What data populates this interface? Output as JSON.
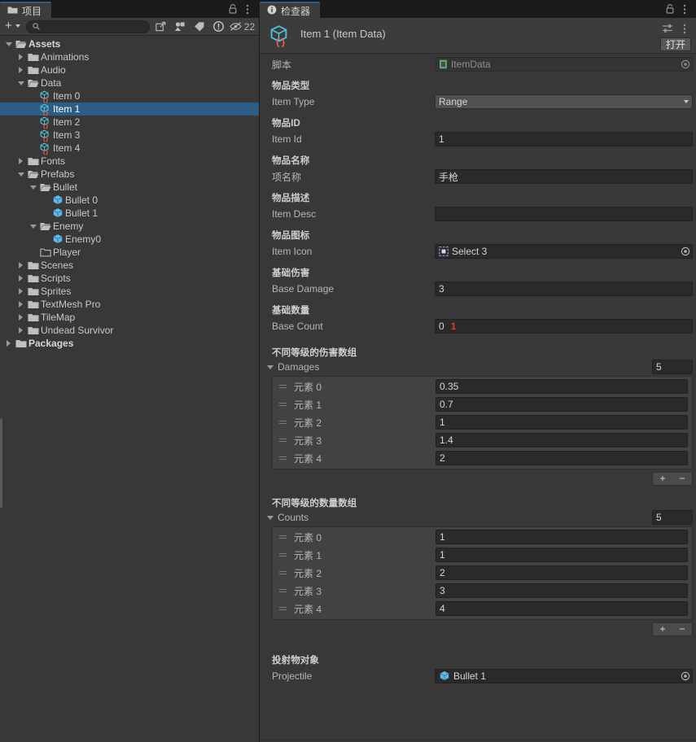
{
  "project": {
    "tab_label": "项目",
    "tab_icon": "folder-icon",
    "toolbar": {
      "add_label": "+",
      "search_value": "",
      "search_placeholder": "",
      "hidden_count": "22"
    },
    "tree": [
      {
        "label": "Assets",
        "depth": 0,
        "expand": "down",
        "icon": "folder-open-icon",
        "bold": true,
        "selected": false
      },
      {
        "label": "Animations",
        "depth": 1,
        "expand": "right",
        "icon": "folder-icon",
        "bold": false,
        "selected": false
      },
      {
        "label": "Audio",
        "depth": 1,
        "expand": "right",
        "icon": "folder-icon",
        "bold": false,
        "selected": false
      },
      {
        "label": "Data",
        "depth": 1,
        "expand": "down",
        "icon": "folder-open-icon",
        "bold": false,
        "selected": false
      },
      {
        "label": "Item 0",
        "depth": 2,
        "expand": "none",
        "icon": "scriptable-object-icon",
        "bold": false,
        "selected": false
      },
      {
        "label": "Item 1",
        "depth": 2,
        "expand": "none",
        "icon": "scriptable-object-icon",
        "bold": false,
        "selected": true
      },
      {
        "label": "Item 2",
        "depth": 2,
        "expand": "none",
        "icon": "scriptable-object-icon",
        "bold": false,
        "selected": false
      },
      {
        "label": "Item 3",
        "depth": 2,
        "expand": "none",
        "icon": "scriptable-object-icon",
        "bold": false,
        "selected": false
      },
      {
        "label": "Item 4",
        "depth": 2,
        "expand": "none",
        "icon": "scriptable-object-icon",
        "bold": false,
        "selected": false
      },
      {
        "label": "Fonts",
        "depth": 1,
        "expand": "right",
        "icon": "folder-icon",
        "bold": false,
        "selected": false
      },
      {
        "label": "Prefabs",
        "depth": 1,
        "expand": "down",
        "icon": "folder-open-icon",
        "bold": false,
        "selected": false
      },
      {
        "label": "Bullet",
        "depth": 2,
        "expand": "down",
        "icon": "folder-open-icon",
        "bold": false,
        "selected": false
      },
      {
        "label": "Bullet 0",
        "depth": 3,
        "expand": "none",
        "icon": "prefab-icon",
        "bold": false,
        "selected": false
      },
      {
        "label": "Bullet 1",
        "depth": 3,
        "expand": "none",
        "icon": "prefab-icon",
        "bold": false,
        "selected": false
      },
      {
        "label": "Enemy",
        "depth": 2,
        "expand": "down",
        "icon": "folder-open-icon",
        "bold": false,
        "selected": false
      },
      {
        "label": "Enemy0",
        "depth": 3,
        "expand": "none",
        "icon": "prefab-icon",
        "bold": false,
        "selected": false
      },
      {
        "label": "Player",
        "depth": 2,
        "expand": "none",
        "icon": "folder-empty-icon",
        "bold": false,
        "selected": false
      },
      {
        "label": "Scenes",
        "depth": 1,
        "expand": "right",
        "icon": "folder-icon",
        "bold": false,
        "selected": false
      },
      {
        "label": "Scripts",
        "depth": 1,
        "expand": "right",
        "icon": "folder-icon",
        "bold": false,
        "selected": false
      },
      {
        "label": "Sprites",
        "depth": 1,
        "expand": "right",
        "icon": "folder-icon",
        "bold": false,
        "selected": false
      },
      {
        "label": "TextMesh Pro",
        "depth": 1,
        "expand": "right",
        "icon": "folder-icon",
        "bold": false,
        "selected": false
      },
      {
        "label": "TileMap",
        "depth": 1,
        "expand": "right",
        "icon": "folder-icon",
        "bold": false,
        "selected": false
      },
      {
        "label": "Undead Survivor",
        "depth": 1,
        "expand": "right",
        "icon": "folder-icon",
        "bold": false,
        "selected": false
      },
      {
        "label": "Packages",
        "depth": 0,
        "expand": "right",
        "icon": "folder-icon",
        "bold": true,
        "selected": false
      }
    ]
  },
  "inspector": {
    "tab_label": "检查器",
    "tab_icon": "info-icon",
    "asset_title": "Item 1 (Item Data)",
    "asset_icon": "scriptable-object-icon",
    "open_button": "打开",
    "script_row": {
      "label": "脚本",
      "value": "ItemData",
      "icon": "cs-script-icon"
    },
    "fields": [
      {
        "tooltip": "物品类型",
        "label": "Item Type",
        "kind": "dropdown",
        "value": "Range"
      },
      {
        "tooltip": "物品ID",
        "label": "Item Id",
        "kind": "text",
        "value": "1"
      },
      {
        "tooltip": "物品名称",
        "label": "项名称",
        "kind": "text",
        "value": "手枪"
      },
      {
        "tooltip": "物品描述",
        "label": "Item Desc",
        "kind": "text",
        "value": ""
      },
      {
        "tooltip": "物品图标",
        "label": "Item Icon",
        "kind": "object",
        "value": "Select 3",
        "icon": "sprite-icon"
      },
      {
        "tooltip": "基础伤害",
        "label": "Base Damage",
        "kind": "text",
        "value": "3"
      },
      {
        "tooltip": "基础数量",
        "label": "Base Count",
        "kind": "text",
        "value": "0",
        "cursor": "1"
      }
    ],
    "arrays": [
      {
        "tooltip": "不同等级的伤害数组",
        "label": "Damages",
        "size": "5",
        "element_prefix": "元素",
        "elements": [
          "0.35",
          "0.7",
          "1",
          "1.4",
          "2"
        ],
        "add_label": "+",
        "remove_label": "−"
      },
      {
        "tooltip": "不同等级的数量数组",
        "label": "Counts",
        "size": "5",
        "element_prefix": "元素",
        "elements": [
          "1",
          "1",
          "2",
          "3",
          "4"
        ],
        "add_label": "+",
        "remove_label": "−"
      }
    ],
    "projectile": {
      "tooltip": "投射物对象",
      "label": "Projectile",
      "value": "Bullet 1",
      "icon": "prefab-icon"
    }
  },
  "colors": {
    "panel_bg": "#383838",
    "selection": "#2c5d87",
    "tab_accent": "#2c5d87",
    "field_bg": "#2a2a2a",
    "array_bg": "#424242",
    "cursor_red": "#e03a2f",
    "prefab_blue": "#5fb8e8",
    "so_cyan": "#4ec3e0",
    "so_orange": "#e8623a",
    "sprite_purple": "#b08fe8",
    "script_green": "#6f9c6f"
  }
}
